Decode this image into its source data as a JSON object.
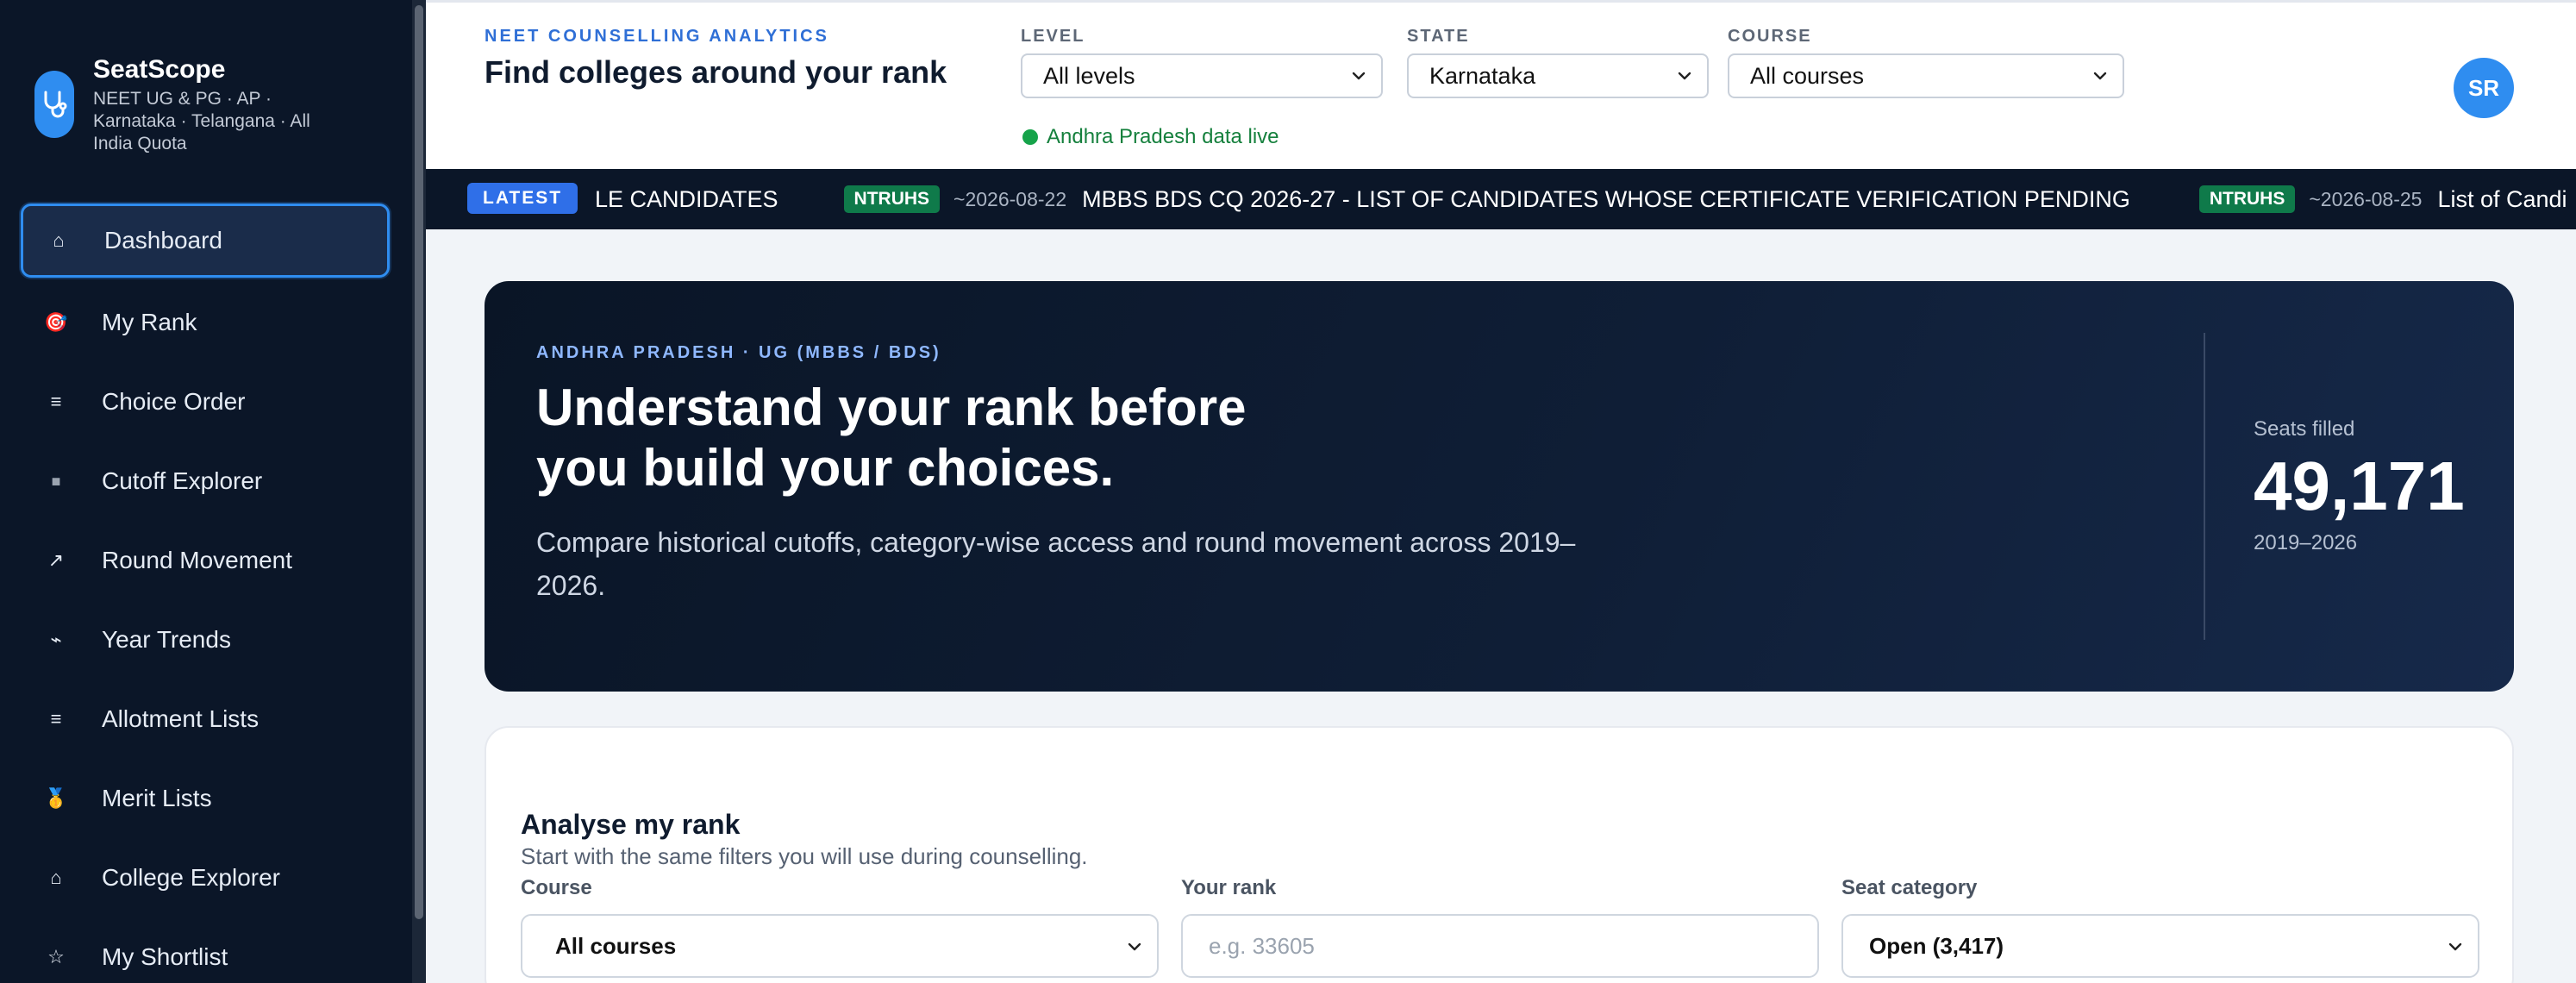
{
  "brand": {
    "name": "SeatScope",
    "subtitle": "NEET UG & PG · AP · Karnataka · Telangana · All India Quota"
  },
  "nav": [
    {
      "label": "Dashboard",
      "icon": "home-icon",
      "glyph": "⌂",
      "active": true
    },
    {
      "label": "My Rank",
      "icon": "target-icon",
      "glyph": "🎯",
      "active": false
    },
    {
      "label": "Choice Order",
      "icon": "list-icon",
      "glyph": "≡",
      "active": false
    },
    {
      "label": "Cutoff Explorer",
      "icon": "grid-icon",
      "glyph": "■",
      "active": false
    },
    {
      "label": "Round Movement",
      "icon": "arrow-up-right-icon",
      "glyph": "↗",
      "active": false
    },
    {
      "label": "Year Trends",
      "icon": "trend-icon",
      "glyph": "⌁",
      "active": false
    },
    {
      "label": "Allotment Lists",
      "icon": "list-icon",
      "glyph": "≡",
      "active": false
    },
    {
      "label": "Merit Lists",
      "icon": "medal-icon",
      "glyph": "🥇",
      "active": false
    },
    {
      "label": "College Explorer",
      "icon": "building-icon",
      "glyph": "⌂",
      "active": false
    },
    {
      "label": "My Shortlist",
      "icon": "star-icon",
      "glyph": "☆",
      "active": false
    }
  ],
  "header": {
    "eyebrow": "NEET COUNSELLING ANALYTICS",
    "title": "Find colleges around your rank",
    "level_label": "LEVEL",
    "level_value": "All levels",
    "state_label": "STATE",
    "state_value": "Karnataka",
    "course_label": "COURSE",
    "course_value": "All courses",
    "live_status": "Andhra Pradesh data live",
    "avatar_initials": "SR"
  },
  "ticker": {
    "latest_label": "LATEST",
    "lead_text": "LE CANDIDATES",
    "items": [
      {
        "badge": "NTRUHS",
        "date": "~2026-08-22",
        "text": "MBBS BDS CQ 2026-27 - LIST OF CANDIDATES WHOSE CERTIFICATE VERIFICATION PENDING"
      },
      {
        "badge": "NTRUHS",
        "date": "~2026-08-25",
        "text": "List of Candi"
      }
    ]
  },
  "hero": {
    "eyebrow": "ANDHRA PRADESH · UG (MBBS / BDS)",
    "title": "Understand your rank before you build your choices.",
    "description": "Compare historical cutoffs, category-wise access and round movement across 2019–2026.",
    "stat_label": "Seats filled",
    "stat_value": "49,171",
    "stat_range": "2019–2026"
  },
  "analyse": {
    "title": "Analyse my rank",
    "subtitle": "Start with the same filters you will use during counselling.",
    "course_label": "Course",
    "course_value": "All courses",
    "rank_label": "Your rank",
    "rank_placeholder": "e.g. 33605",
    "category_label": "Seat category",
    "category_value": "Open (3,417)"
  },
  "colors": {
    "sidebar_bg": "#0b1628",
    "accent": "#2f8df0",
    "live_green": "#16a34a",
    "badge_green": "#0f7a4a"
  }
}
